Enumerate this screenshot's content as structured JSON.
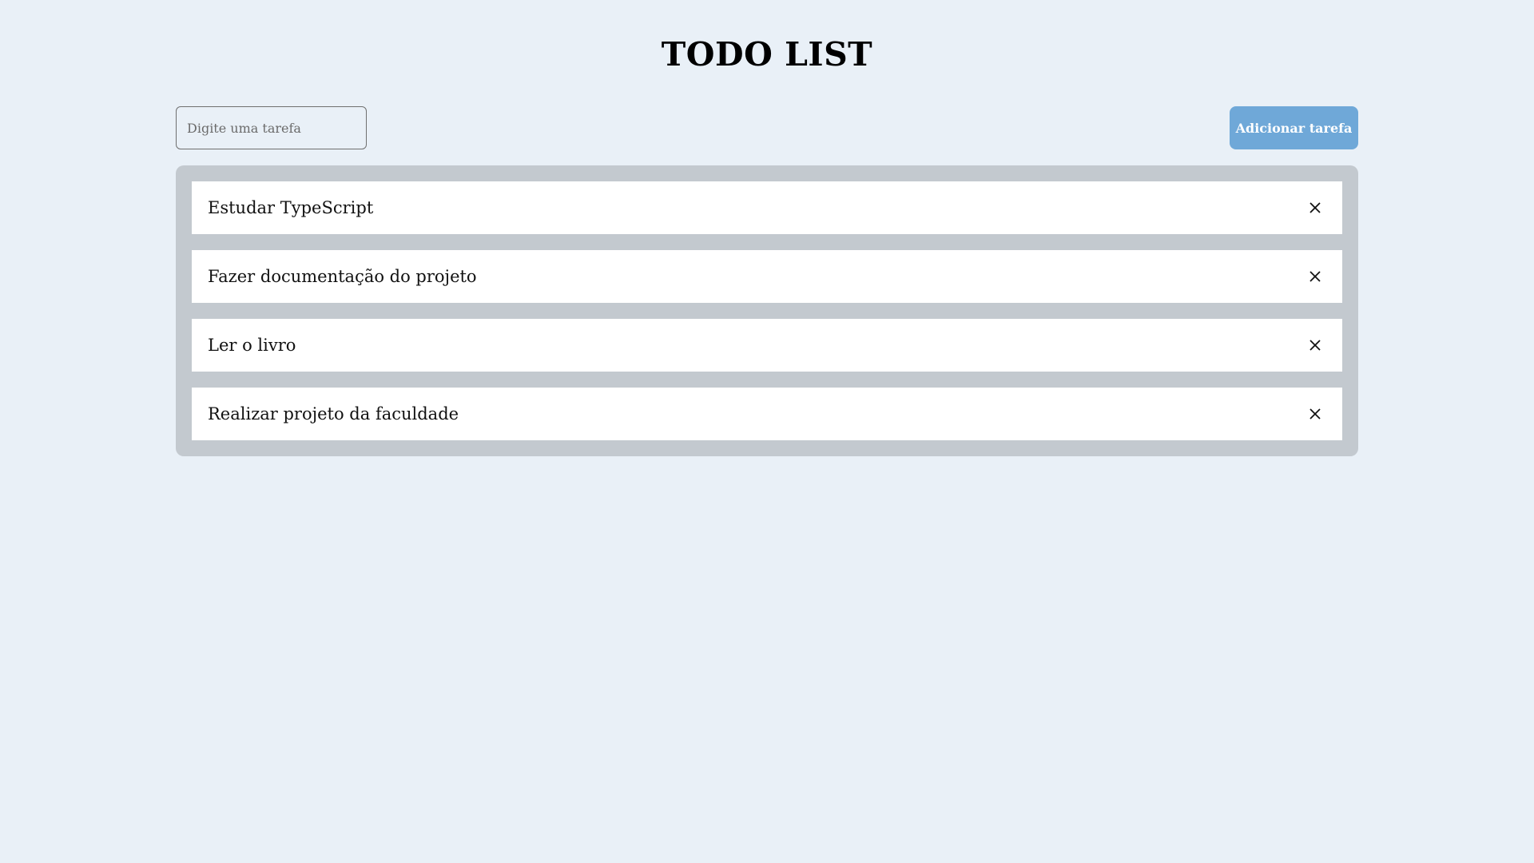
{
  "header": {
    "title": "TODO LIST"
  },
  "form": {
    "input_value": "",
    "input_placeholder": "Digite uma tarefa",
    "add_label": "Adicionar tarefa"
  },
  "tasks": [
    {
      "text": "Estudar TypeScript",
      "delete_icon": "close-icon"
    },
    {
      "text": "Fazer documentação do projeto",
      "delete_icon": "close-icon"
    },
    {
      "text": "Ler o livro",
      "delete_icon": "close-icon"
    },
    {
      "text": "Realizar projeto da faculdade",
      "delete_icon": "close-icon"
    }
  ],
  "colors": {
    "background": "#e9f0f7",
    "list_background": "#c3c9cf",
    "button_background": "#6fa8d8",
    "item_background": "#ffffff"
  }
}
